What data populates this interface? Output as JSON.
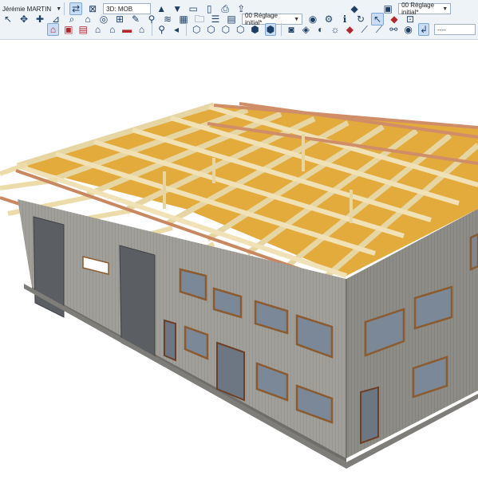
{
  "toolbar": {
    "user_name": "Jérémie MARTIN",
    "view_name": "3D: MOB",
    "graphic_override_left": "00 Réglage initial*",
    "graphic_override_right": "00 Réglage initial*",
    "scale_field": "----"
  },
  "colors": {
    "toolbar_bg": "#eef3f8",
    "wall_cladding": "#9d9c97",
    "timber": "#e9d8a8",
    "glulam_red": "#c98760",
    "insulation": "#e0a63a",
    "window_frame": "#8b5a2f",
    "glass": "#7a8796",
    "door_dark": "#5a5d62"
  }
}
